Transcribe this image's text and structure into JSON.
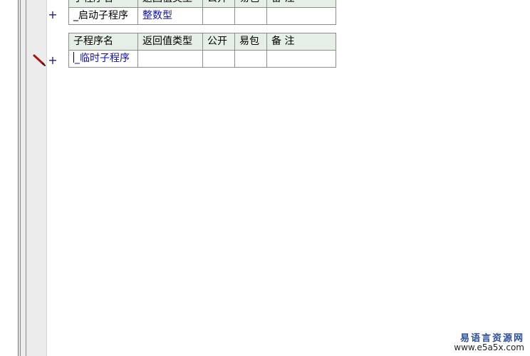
{
  "table1": {
    "header": [
      "子程序名",
      "返回值类型",
      "公开",
      "易包",
      "备 注"
    ],
    "row": {
      "marker": "+",
      "name": "_启动子程序",
      "return_type": "整数型",
      "public": "",
      "easy_package": "",
      "remark": ""
    }
  },
  "table2": {
    "header": [
      "子程序名",
      "返回值类型",
      "公开",
      "易包",
      "备 注"
    ],
    "row": {
      "marker": "+",
      "name": "_临时子程序",
      "return_type": "",
      "public": "",
      "easy_package": "",
      "remark": ""
    }
  },
  "colors": {
    "header_bg": "#e6efe6",
    "blue_text": "#1010b0",
    "pencil": "#b01010"
  },
  "icons": {
    "edit_marker": "pencil-icon"
  },
  "watermark": {
    "line1": "易语言资源网",
    "line2": "www.e5a5x.com"
  }
}
